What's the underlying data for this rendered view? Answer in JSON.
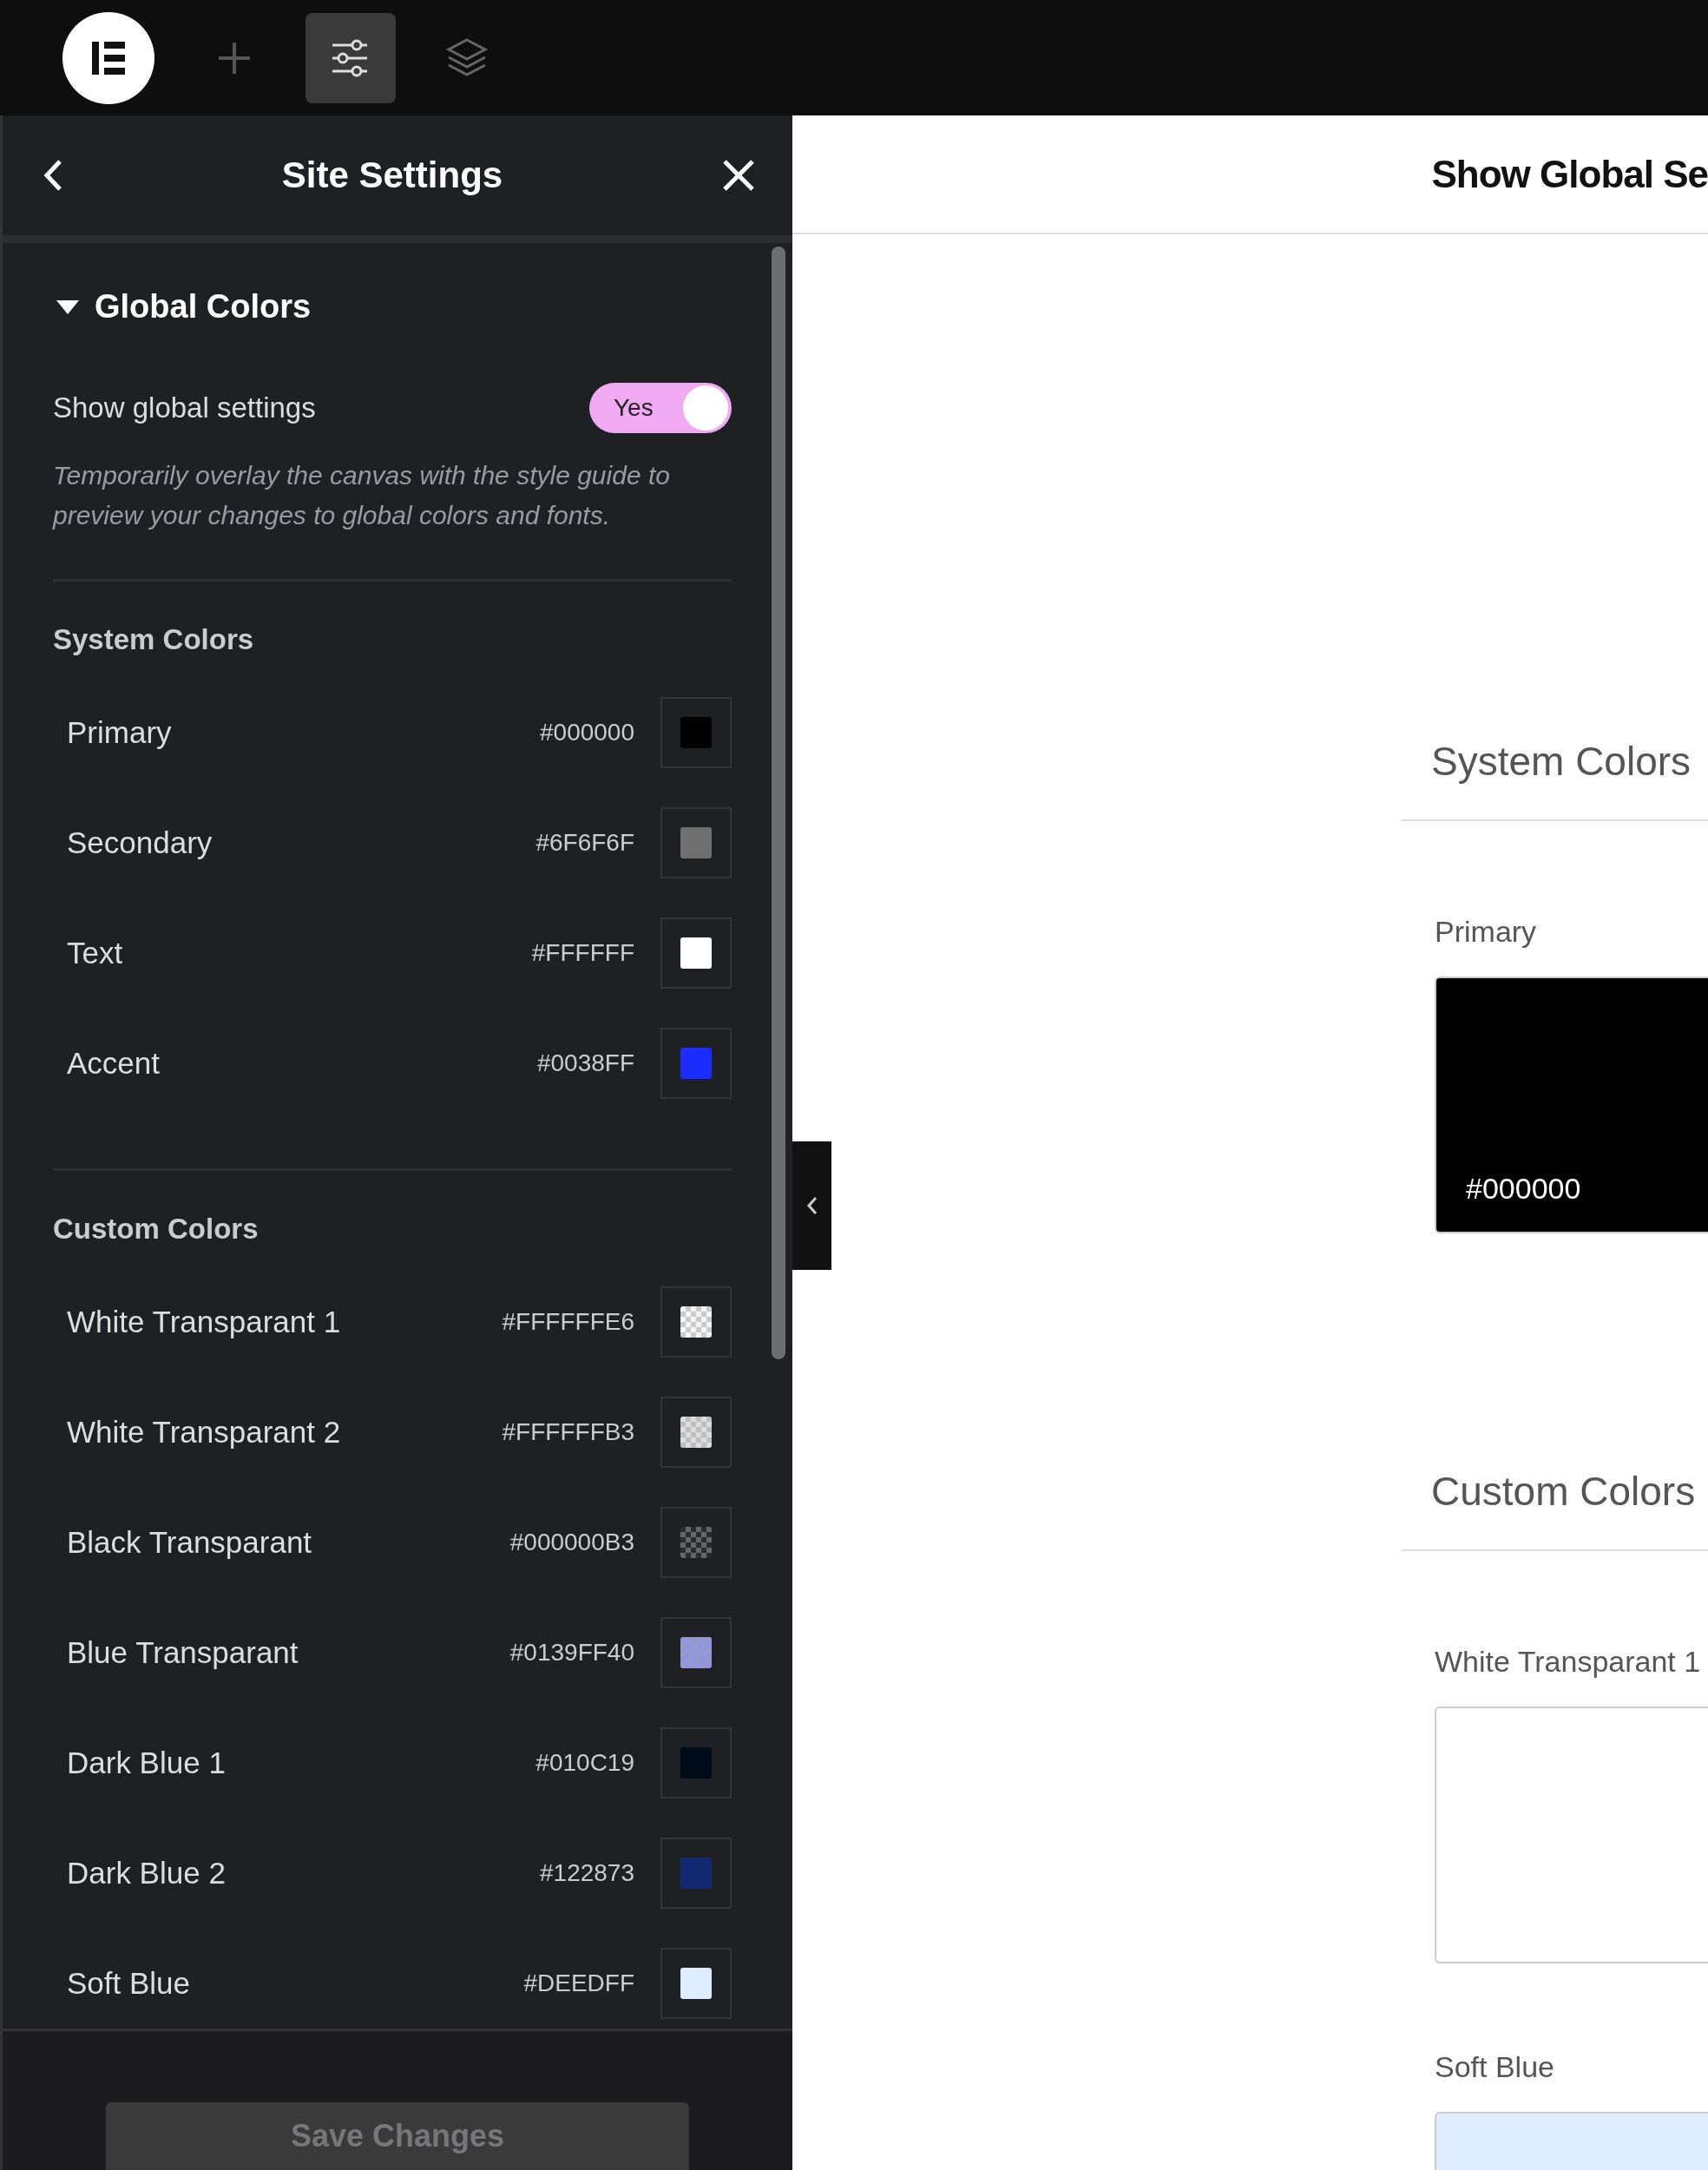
{
  "toolbar": [
    {
      "kind": "logo",
      "selected": false
    },
    {
      "kind": "add",
      "selected": false
    },
    {
      "kind": "settings",
      "selected": true
    },
    {
      "kind": "layers",
      "selected": false
    }
  ],
  "panel": {
    "title": "Site Settings",
    "section": {
      "title": "Global Colors",
      "expanded": true,
      "toggle": {
        "label": "Show global settings",
        "text": "Yes",
        "on": true
      },
      "description": "Temporarily overlay the canvas with the style guide to preview your changes to global colors and fonts.",
      "groups": [
        {
          "title": "System Colors",
          "items": [
            {
              "name": "Primary",
              "hex": "#000000",
              "color": "#000000",
              "transparent": false
            },
            {
              "name": "Secondary",
              "hex": "#6F6F6F",
              "color": "#6f6f6f",
              "transparent": false
            },
            {
              "name": "Text",
              "hex": "#FFFFFF",
              "color": "#ffffff",
              "transparent": false
            },
            {
              "name": "Accent",
              "hex": "#0038FF",
              "color": "#1b2cff",
              "transparent": false
            }
          ]
        },
        {
          "title": "Custom Colors",
          "items": [
            {
              "name": "White Transparant 1",
              "hex": "#FFFFFFE6",
              "color": "#f4f4f4",
              "transparent": true
            },
            {
              "name": "White Transparant 2",
              "hex": "#FFFFFFB3",
              "color": "#dddddd",
              "transparent": true
            },
            {
              "name": "Black Transparant",
              "hex": "#000000B3",
              "color": "#2a2b2e",
              "transparent": true
            },
            {
              "name": "Blue Transparant",
              "hex": "#0139FF40",
              "color": "#8e94e6",
              "transparent": true
            },
            {
              "name": "Dark Blue 1",
              "hex": "#010C19",
              "color": "#010c19",
              "transparent": false
            },
            {
              "name": "Dark Blue 2",
              "hex": "#122873",
              "color": "#122873",
              "transparent": false
            },
            {
              "name": "Soft Blue",
              "hex": "#DEEDFF",
              "color": "#deedff",
              "transparent": false
            }
          ]
        }
      ]
    },
    "save_button": {
      "label": "Save Changes",
      "disabled": true
    }
  },
  "canvas": {
    "title": "Show Global Se",
    "groups": [
      {
        "title": "System Colors",
        "items": [
          {
            "name": "Primary",
            "hex": "#000000",
            "color": "#000000"
          }
        ]
      },
      {
        "title": "Custom Colors",
        "items": [
          {
            "name": "White Transparant 1",
            "color": "#ffffff"
          },
          {
            "name": "Soft Blue",
            "color": "#deedff"
          }
        ]
      }
    ]
  }
}
